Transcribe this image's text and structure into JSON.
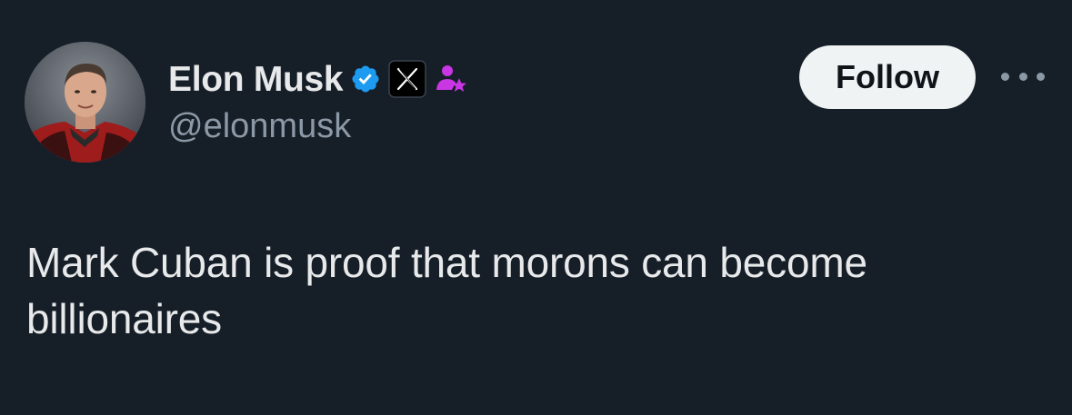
{
  "tweet": {
    "author": {
      "display_name": "Elon Musk",
      "handle": "@elonmusk",
      "avatar_icon": "profile-photo",
      "badges": [
        "verified-badge-icon",
        "x-affiliate-badge-icon",
        "creator-star-badge-icon"
      ]
    },
    "follow_label": "Follow",
    "more_icon": "more-options-icon",
    "text": "Mark Cuban is proof that morons can become billionaires"
  },
  "colors": {
    "background": "#161e28",
    "primary_text": "#e7e9ea",
    "secondary_text": "#8b98a5",
    "verified_blue": "#1d9bf0",
    "badge_purple": "#c936e3",
    "follow_bg": "#eff3f4"
  }
}
